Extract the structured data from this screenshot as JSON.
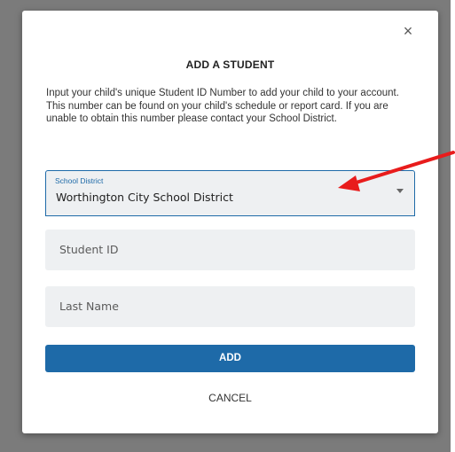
{
  "modal": {
    "close_symbol": "×",
    "title": "ADD A STUDENT",
    "description": "Input your child's unique Student ID Number to add your child to your account. This number can be found on your child's schedule or report card. If you are unable to obtain this number please contact your School District.",
    "district_field": {
      "label": "School District",
      "value": "Worthington City School District"
    },
    "student_id_field": {
      "placeholder": "Student ID"
    },
    "last_name_field": {
      "placeholder": "Last Name"
    },
    "add_button_label": "ADD",
    "cancel_button_label": "CANCEL"
  },
  "colors": {
    "accent": "#1e6aa8",
    "annotation_arrow": "#e81c1c",
    "backdrop": "#7b7b7b"
  },
  "icons": {
    "close": "close-icon",
    "dropdown": "chevron-down-icon",
    "annotation": "arrow-icon"
  }
}
